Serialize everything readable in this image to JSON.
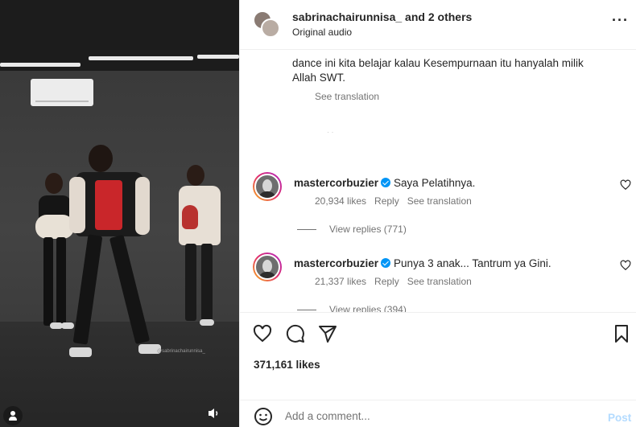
{
  "header": {
    "username": "sabrinachairunnisa_",
    "others": " and 2 others",
    "audio": "Original audio"
  },
  "caption": {
    "line1": "dance ini kita belajar kalau Kesempurnaan itu hanyalah milik",
    "line2": "Allah SWT.",
    "see_translation": "See translation"
  },
  "comments": [
    {
      "username": "mastercorbuzier",
      "text": "Saya Pelatihnya.",
      "likes": "20,934 likes",
      "reply": "Reply",
      "see_translation": "See translation",
      "view_replies": "View replies (771)"
    },
    {
      "username": "mastercorbuzier",
      "text": "Punya 3 anak... Tantrum ya Gini.",
      "likes": "21,337 likes",
      "reply": "Reply",
      "see_translation": "See translation",
      "view_replies": "View replies (394)"
    }
  ],
  "post": {
    "likes": "371,161 likes",
    "watermark": "@sabrinachairunnisa_"
  },
  "composer": {
    "placeholder": "Add a comment...",
    "post_label": "Post"
  },
  "icons": {
    "like": "heart-icon",
    "comment": "comment-icon",
    "share": "share-icon",
    "save": "bookmark-icon",
    "emoji": "emoji-icon",
    "more": "more-icon",
    "mute": "audio-icon",
    "user_tags": "user-icon"
  },
  "colors": {
    "verified": "#0095f6",
    "post_disabled": "#b3dbff",
    "secondary_text": "#737373"
  }
}
